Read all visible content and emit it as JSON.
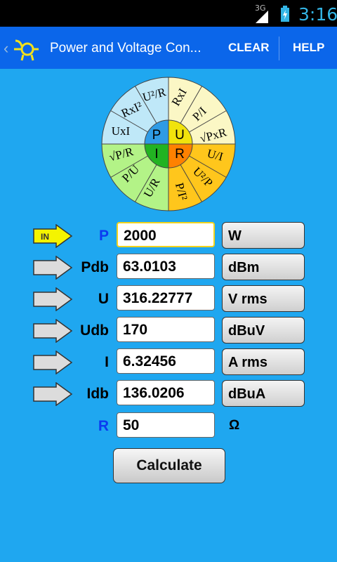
{
  "status": {
    "network": "3G",
    "time": "3:16"
  },
  "actionbar": {
    "title": "Power and Voltage Con...",
    "clear_label": "CLEAR",
    "help_label": "HELP"
  },
  "wheel": {
    "center": [
      "P",
      "U",
      "I",
      "R"
    ],
    "segments": [
      "U²/R",
      "RxI",
      "P/I",
      "√PxR",
      "U/I",
      "U²/P",
      "P/I²",
      "U/R",
      "P/U",
      "√P/R",
      "UxI",
      "RxI²"
    ],
    "colors": {
      "P": "#9fdcf5",
      "U": "#f6ec66",
      "I": "#a8f07e",
      "R": "#ffa500",
      "center_P": "#2f9be5",
      "center_U": "#f1e30c",
      "center_I": "#22b322",
      "center_R": "#ff8100"
    }
  },
  "rows": [
    {
      "label": "P",
      "value": "2000",
      "unit": "W",
      "arrow": "IN"
    },
    {
      "label": "Pdb",
      "value": "63.0103",
      "unit": "dBm"
    },
    {
      "label": "U",
      "value": "316.22777",
      "unit": "V rms"
    },
    {
      "label": "Udb",
      "value": "170",
      "unit": "dBuV"
    },
    {
      "label": "I",
      "value": "6.32456",
      "unit": "A rms"
    },
    {
      "label": "Idb",
      "value": "136.0206",
      "unit": "dBuA"
    }
  ],
  "resistance": {
    "label": "R",
    "value": "50",
    "unit": "Ω"
  },
  "calculate_label": "Calculate"
}
